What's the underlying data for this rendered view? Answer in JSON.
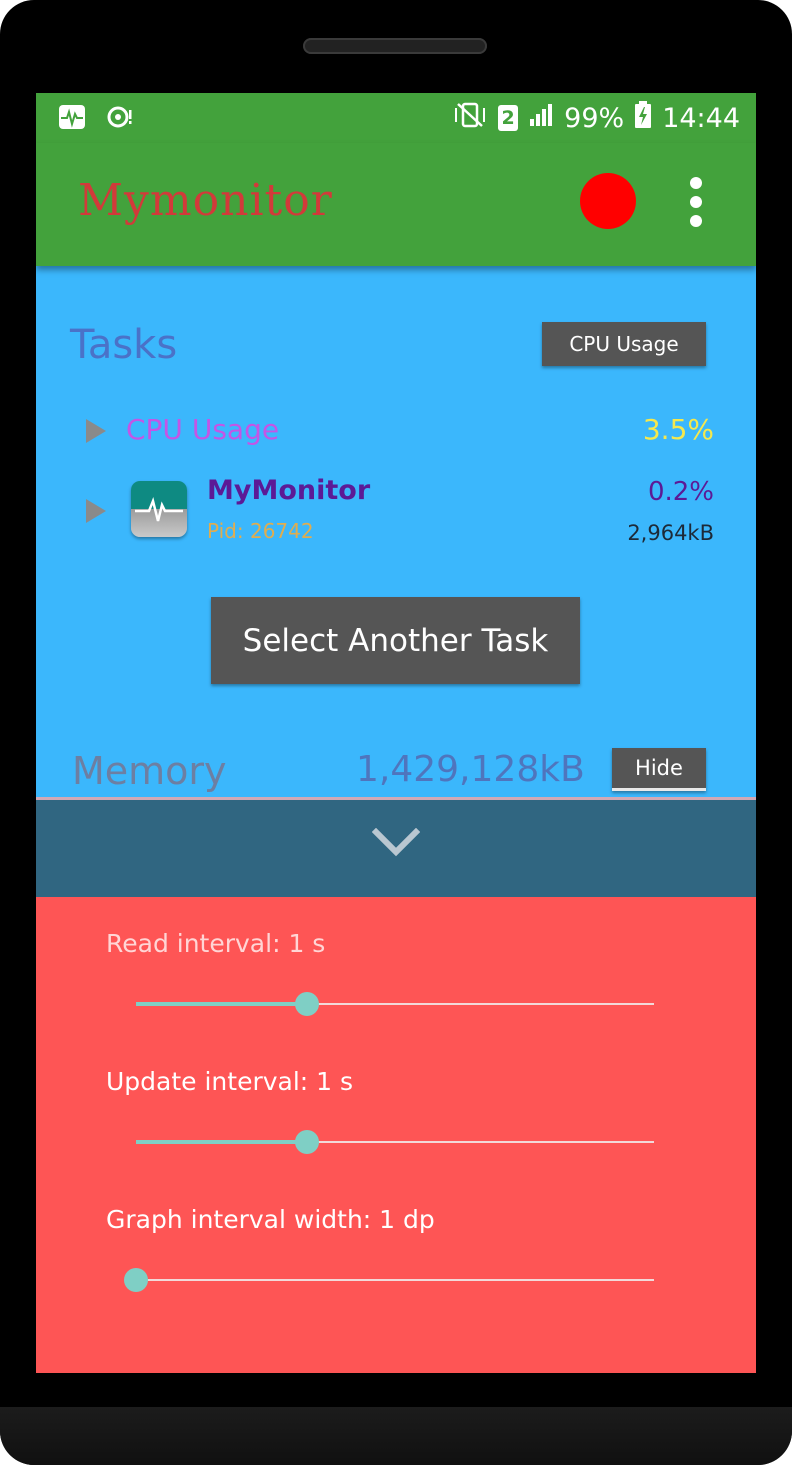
{
  "status_bar": {
    "left_icons": [
      "activity-monitor-icon",
      "sync-alert-icon"
    ],
    "sim_slot": "2",
    "battery": "99%",
    "time": "14:44",
    "icons": [
      "vibrate-icon",
      "signal-icon",
      "battery-charging-icon"
    ]
  },
  "app_bar": {
    "title": "Mymonitor",
    "record_color": "#ff0000",
    "menu_icon": "overflow-menu-icon"
  },
  "tasks": {
    "title": "Tasks",
    "sort_button": "CPU Usage",
    "cpu_row": {
      "label": "CPU Usage",
      "value": "3.5%"
    },
    "process_row": {
      "name": "MyMonitor",
      "pid": "Pid: 26742",
      "cpu": "0.2%",
      "memory": "2,964kB"
    },
    "select_button": "Select Another Task"
  },
  "memory": {
    "title": "Memory",
    "value": "1,429,128kB",
    "hide_button": "Hide"
  },
  "collapse": {
    "icon": "chevron-down-icon"
  },
  "settings": {
    "read_interval": {
      "label": "Read interval: 1 s",
      "fraction": 0.33
    },
    "update_interval": {
      "label": "Update interval: 1 s",
      "fraction": 0.33
    },
    "graph_width": {
      "label": "Graph interval width: 1 dp",
      "fraction": 0.0
    }
  },
  "colors": {
    "appbar": "#43a23c",
    "main_bg": "#3bb7fc",
    "settings_bg": "#fe5555",
    "collapse_bar": "#306681",
    "slider_accent": "#7fcfc5"
  }
}
